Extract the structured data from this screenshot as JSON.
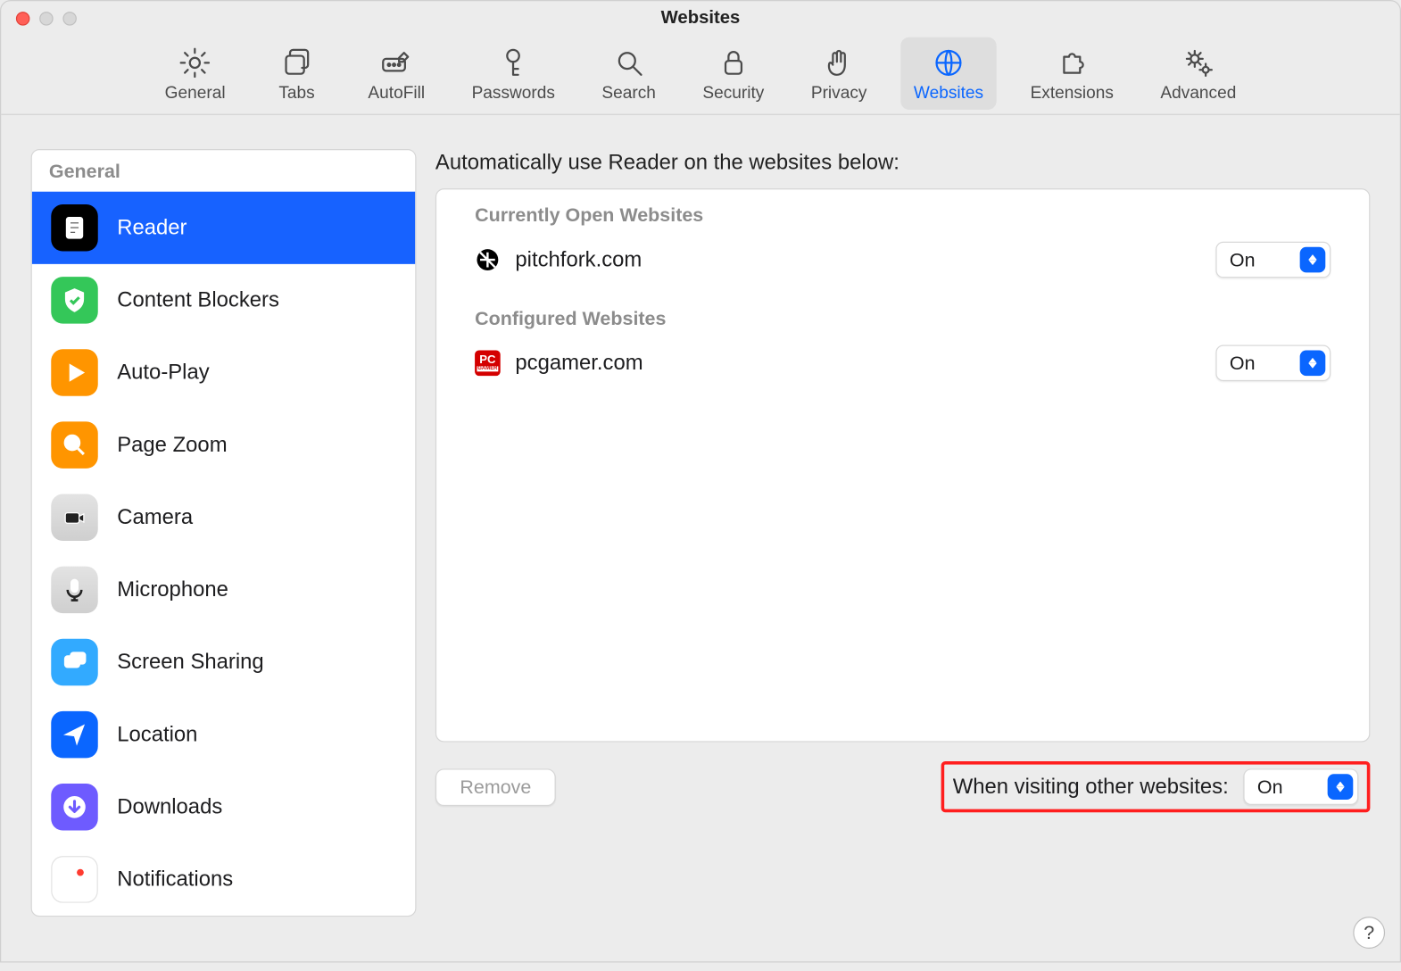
{
  "window": {
    "title": "Websites"
  },
  "toolbar": {
    "items": [
      {
        "id": "general",
        "label": "General"
      },
      {
        "id": "tabs",
        "label": "Tabs"
      },
      {
        "id": "autofill",
        "label": "AutoFill"
      },
      {
        "id": "passwords",
        "label": "Passwords"
      },
      {
        "id": "search",
        "label": "Search"
      },
      {
        "id": "security",
        "label": "Security"
      },
      {
        "id": "privacy",
        "label": "Privacy"
      },
      {
        "id": "websites",
        "label": "Websites",
        "active": true
      },
      {
        "id": "extensions",
        "label": "Extensions"
      },
      {
        "id": "advanced",
        "label": "Advanced"
      }
    ]
  },
  "sidebar": {
    "header": "General",
    "items": [
      {
        "id": "reader",
        "label": "Reader",
        "color": "#000000",
        "selected": true
      },
      {
        "id": "content-blockers",
        "label": "Content Blockers",
        "color": "#34c759"
      },
      {
        "id": "autoplay",
        "label": "Auto-Play",
        "color": "#ff9500"
      },
      {
        "id": "page-zoom",
        "label": "Page Zoom",
        "color": "#ff9500"
      },
      {
        "id": "camera",
        "label": "Camera",
        "color": "#c9c9c9"
      },
      {
        "id": "microphone",
        "label": "Microphone",
        "color": "#c9c9c9"
      },
      {
        "id": "screen-sharing",
        "label": "Screen Sharing",
        "color": "#32aaff"
      },
      {
        "id": "location",
        "label": "Location",
        "color": "#0a66ff"
      },
      {
        "id": "downloads",
        "label": "Downloads",
        "color": "#6e5bff"
      },
      {
        "id": "notifications",
        "label": "Notifications",
        "color": "#ffffff"
      }
    ]
  },
  "detail": {
    "title": "Automatically use Reader on the websites below:",
    "section_open": "Currently Open Websites",
    "open_sites": [
      {
        "domain": "pitchfork.com",
        "value": "On"
      }
    ],
    "section_conf": "Configured Websites",
    "configured_sites": [
      {
        "domain": "pcgamer.com",
        "value": "On"
      }
    ],
    "remove_label": "Remove",
    "other_label": "When visiting other websites:",
    "other_value": "On"
  },
  "help": "?"
}
